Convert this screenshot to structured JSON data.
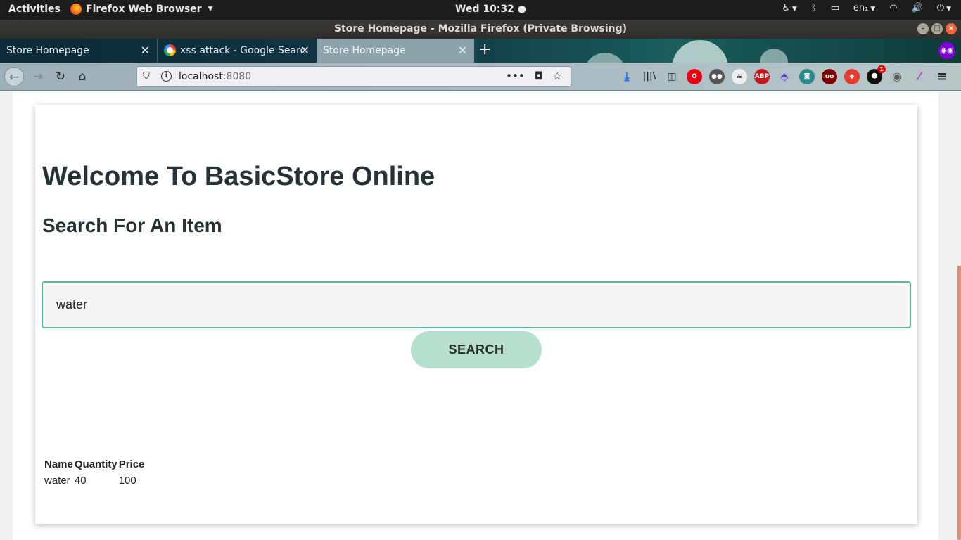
{
  "topbar": {
    "activities": "Activities",
    "app_name": "Firefox Web Browser",
    "clock": "Wed 10:32",
    "language": "en₁"
  },
  "window": {
    "title": "Store Homepage - Mozilla Firefox (Private Browsing)"
  },
  "tabs": [
    {
      "label": "Store Homepage",
      "active": false
    },
    {
      "label": "xss attack - Google Searc",
      "active": false
    },
    {
      "label": "Store Homepage",
      "active": true
    }
  ],
  "urlbar": {
    "host": "localhost",
    "port": ":8080"
  },
  "toolbar": {
    "notification_badge": "1"
  },
  "page": {
    "heading": "Welcome To BasicStore Online",
    "subheading": "Search For An Item",
    "search_value": "water",
    "search_button": "SEARCH",
    "results": {
      "columns": [
        "Name",
        "Quantity",
        "Price"
      ],
      "rows": [
        {
          "name": "water",
          "quantity": "40",
          "price": "100"
        }
      ]
    }
  },
  "colors": {
    "input_border": "#5cb9a0",
    "button_bg": "#b4e0cc",
    "text": "#263238",
    "scroll_thumb": "#e8896b"
  }
}
